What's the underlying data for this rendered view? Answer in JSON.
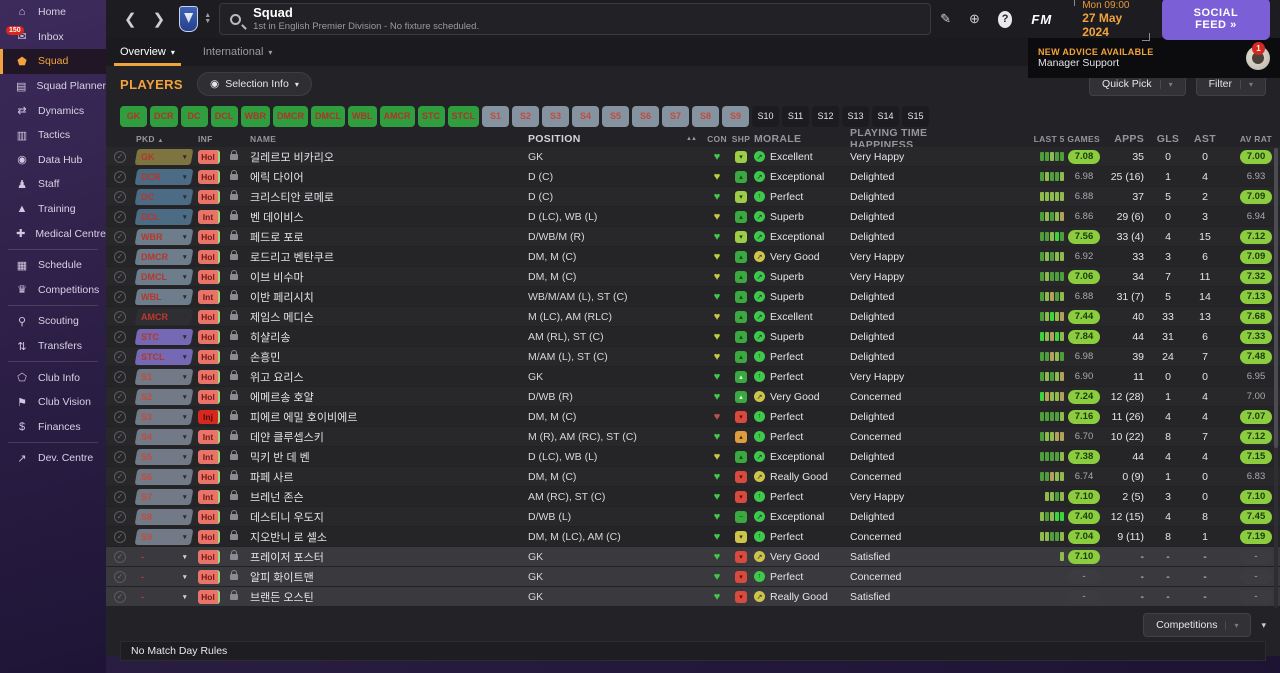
{
  "sidebar": {
    "items": [
      {
        "label": "Home",
        "icon": "home-icon",
        "glyph": "⌂"
      },
      {
        "label": "Inbox",
        "icon": "inbox-icon",
        "glyph": "✉",
        "badge": "150"
      },
      {
        "label": "Squad",
        "icon": "shirt-icon",
        "glyph": "⬟",
        "active": true
      },
      {
        "label": "Squad Planner",
        "icon": "clipboard-icon",
        "glyph": "▤"
      },
      {
        "label": "Dynamics",
        "icon": "dynamics-icon",
        "glyph": "⇄"
      },
      {
        "label": "Tactics",
        "icon": "tactics-board-icon",
        "glyph": "▥"
      },
      {
        "label": "Data Hub",
        "icon": "data-hub-icon",
        "glyph": "◉"
      },
      {
        "label": "Staff",
        "icon": "staff-icon",
        "glyph": "♟"
      },
      {
        "label": "Training",
        "icon": "training-icon",
        "glyph": "▲"
      },
      {
        "label": "Medical Centre",
        "icon": "medical-cross-icon",
        "glyph": "✚",
        "sep_after": true
      },
      {
        "label": "Schedule",
        "icon": "calendar-icon",
        "glyph": "▦"
      },
      {
        "label": "Competitions",
        "icon": "trophy-icon",
        "glyph": "♛",
        "sep_after": true
      },
      {
        "label": "Scouting",
        "icon": "magnifier-icon",
        "glyph": "⚲"
      },
      {
        "label": "Transfers",
        "icon": "transfers-icon",
        "glyph": "⇅",
        "sep_after": true
      },
      {
        "label": "Club Info",
        "icon": "shield-icon",
        "glyph": "⬠"
      },
      {
        "label": "Club Vision",
        "icon": "briefcase-icon",
        "glyph": "⚑"
      },
      {
        "label": "Finances",
        "icon": "finances-icon",
        "glyph": "$",
        "sep_after": true
      },
      {
        "label": "Dev. Centre",
        "icon": "growth-icon",
        "glyph": "↗"
      }
    ]
  },
  "topbar": {
    "title": "Squad",
    "subtitle": "1st in English Premier Division - No fixture scheduled.",
    "date_line1": "Mon 09:00",
    "date_line2": "27 May 2024",
    "social_feed": "SOCIAL FEED",
    "social_feed_arrow": "»",
    "fm_logo": "FM"
  },
  "advice": {
    "line1": "NEW ADVICE AVAILABLE",
    "line2": "Manager Support",
    "badge": "1"
  },
  "tabs": [
    {
      "label": "Overview",
      "active": true
    },
    {
      "label": "International",
      "active": false
    }
  ],
  "players_panel": {
    "title": "PLAYERS",
    "selection_info": "Selection Info",
    "quick_pick": "Quick Pick",
    "filter": "Filter",
    "position_buttons": [
      {
        "label": "GK",
        "style": "green"
      },
      {
        "label": "DCR",
        "style": "green"
      },
      {
        "label": "DC",
        "style": "green"
      },
      {
        "label": "DCL",
        "style": "green"
      },
      {
        "label": "WBR",
        "style": "green"
      },
      {
        "label": "DMCR",
        "style": "green"
      },
      {
        "label": "DMCL",
        "style": "green"
      },
      {
        "label": "WBL",
        "style": "green"
      },
      {
        "label": "AMCR",
        "style": "green"
      },
      {
        "label": "STC",
        "style": "green"
      },
      {
        "label": "STCL",
        "style": "green"
      },
      {
        "label": "S1",
        "style": "gray"
      },
      {
        "label": "S2",
        "style": "gray"
      },
      {
        "label": "S3",
        "style": "gray"
      },
      {
        "label": "S4",
        "style": "gray"
      },
      {
        "label": "S5",
        "style": "gray"
      },
      {
        "label": "S6",
        "style": "gray"
      },
      {
        "label": "S7",
        "style": "gray"
      },
      {
        "label": "S8",
        "style": "gray"
      },
      {
        "label": "S9",
        "style": "gray"
      },
      {
        "label": "S10",
        "style": "dark"
      },
      {
        "label": "S11",
        "style": "dark"
      },
      {
        "label": "S12",
        "style": "dark"
      },
      {
        "label": "S13",
        "style": "dark"
      },
      {
        "label": "S14",
        "style": "dark"
      },
      {
        "label": "S15",
        "style": "dark"
      }
    ]
  },
  "table": {
    "headers": {
      "pkd": "PKD",
      "sort": "▲",
      "inf": "INF",
      "name": "NAME",
      "position": "POSITION",
      "aa": "▲▲",
      "con": "CON",
      "shp": "SHP",
      "morale": "MORALE",
      "happiness": "PLAYING TIME HAPPINESS",
      "last5": "LAST 5 GAMES",
      "apps": "APPS",
      "gls": "GLS",
      "ast": "AST",
      "avrat": "AV RAT"
    },
    "rows": [
      {
        "pkd": "GK",
        "pkd_style": "gk",
        "inf": "Hol",
        "name": "길레르모 비카리오",
        "position": "GK",
        "con": "g",
        "shp": "l",
        "shp_glyph": "▾",
        "morale_color": "g",
        "morale_glyph": "↗",
        "morale": "Excellent",
        "happiness": "Very Happy",
        "blocks": [
          "g",
          "g",
          "l",
          "g",
          "g"
        ],
        "last5": "7.08",
        "last5_style": "green",
        "apps": "35",
        "gls": "0",
        "ast": "0",
        "avrat": "7.00",
        "avrat_style": "green"
      },
      {
        "pkd": "DCR",
        "pkd_style": "d",
        "inf": "Hol",
        "name": "에릭 다이어",
        "position": "D (C)",
        "con": "y",
        "shp": "g",
        "shp_glyph": "▴",
        "morale_color": "g",
        "morale_glyph": "↗",
        "morale": "Exceptional",
        "happiness": "Delighted",
        "blocks": [
          "g",
          "l",
          "g",
          "g",
          "l"
        ],
        "last5": "6.98",
        "last5_style": "plain",
        "apps": "25 (16)",
        "gls": "1",
        "ast": "4",
        "avrat": "6.93",
        "avrat_style": "plain"
      },
      {
        "pkd": "DC",
        "pkd_style": "d",
        "inf": "Hol",
        "name": "크리스티안 로메로",
        "position": "D (C)",
        "con": "g",
        "shp": "l",
        "shp_glyph": "▾",
        "morale_color": "g",
        "morale_glyph": "↑",
        "morale": "Perfect",
        "happiness": "Delighted",
        "blocks": [
          "l",
          "l",
          "l",
          "l",
          "l"
        ],
        "last5": "6.88",
        "last5_style": "plain",
        "apps": "37",
        "gls": "5",
        "ast": "2",
        "avrat": "7.09",
        "avrat_style": "green"
      },
      {
        "pkd": "DCL",
        "pkd_style": "d",
        "inf": "Int",
        "name": "벤 데이비스",
        "position": "D (LC), WB (L)",
        "con": "y",
        "shp": "g",
        "shp_glyph": "▴",
        "morale_color": "g",
        "morale_glyph": "↗",
        "morale": "Superb",
        "happiness": "Delighted",
        "blocks": [
          "g",
          "l",
          "g",
          "l",
          "t"
        ],
        "last5": "6.86",
        "last5_style": "plain",
        "apps": "29 (6)",
        "gls": "0",
        "ast": "3",
        "avrat": "6.94",
        "avrat_style": "plain"
      },
      {
        "pkd": "WBR",
        "pkd_style": "wb",
        "inf": "Hol",
        "name": "페드로 포로",
        "position": "D/WB/M (R)",
        "con": "g",
        "shp": "l",
        "shp_glyph": "▾",
        "morale_color": "g",
        "morale_glyph": "↗",
        "morale": "Exceptional",
        "happiness": "Delighted",
        "blocks": [
          "g",
          "g",
          "l",
          "G",
          "g"
        ],
        "last5": "7.56",
        "last5_style": "green",
        "apps": "33 (4)",
        "gls": "4",
        "ast": "15",
        "avrat": "7.12",
        "avrat_style": "green"
      },
      {
        "pkd": "DMCR",
        "pkd_style": "wb",
        "inf": "Hol",
        "name": "로드리고 벤탄쿠르",
        "position": "DM, M (C)",
        "con": "y",
        "shp": "g",
        "shp_glyph": "▴",
        "morale_color": "y",
        "morale_glyph": "↗",
        "morale": "Very Good",
        "happiness": "Very Happy",
        "blocks": [
          "g",
          "l",
          "g",
          "l",
          "l"
        ],
        "last5": "6.92",
        "last5_style": "plain",
        "apps": "33",
        "gls": "3",
        "ast": "6",
        "avrat": "7.09",
        "avrat_style": "green"
      },
      {
        "pkd": "DMCL",
        "pkd_style": "wb",
        "inf": "Hol",
        "name": "이브 비수마",
        "position": "DM, M (C)",
        "con": "y",
        "shp": "g",
        "shp_glyph": "▴",
        "morale_color": "g",
        "morale_glyph": "↗",
        "morale": "Superb",
        "happiness": "Very Happy",
        "blocks": [
          "g",
          "l",
          "g",
          "g",
          "g"
        ],
        "last5": "7.06",
        "last5_style": "green",
        "apps": "34",
        "gls": "7",
        "ast": "11",
        "avrat": "7.32",
        "avrat_style": "green"
      },
      {
        "pkd": "WBL",
        "pkd_style": "wb",
        "inf": "Int",
        "name": "이반 페리시치",
        "position": "WB/M/AM (L), ST (C)",
        "con": "g",
        "shp": "g",
        "shp_glyph": "▴",
        "morale_color": "g",
        "morale_glyph": "↗",
        "morale": "Superb",
        "happiness": "Delighted",
        "blocks": [
          "g",
          "l",
          "t",
          "g",
          "l"
        ],
        "last5": "6.88",
        "last5_style": "plain",
        "apps": "31 (7)",
        "gls": "5",
        "ast": "14",
        "avrat": "7.13",
        "avrat_style": "green"
      },
      {
        "pkd": "AMCR",
        "pkd_style": "am",
        "inf": "Hol",
        "name": "제임스 메디슨",
        "position": "M (LC), AM (RLC)",
        "con": "y",
        "shp": "g",
        "shp_glyph": "▴",
        "morale_color": "g",
        "morale_glyph": "↗",
        "morale": "Excellent",
        "happiness": "Delighted",
        "blocks": [
          "g",
          "l",
          "G",
          "l",
          "t"
        ],
        "last5": "7.44",
        "last5_style": "green",
        "apps": "40",
        "gls": "33",
        "ast": "13",
        "avrat": "7.68",
        "avrat_style": "green"
      },
      {
        "pkd": "STC",
        "pkd_style": "st",
        "inf": "Hol",
        "name": "히샬리송",
        "position": "AM (RL), ST (C)",
        "con": "y",
        "shp": "g",
        "shp_glyph": "▴",
        "morale_color": "g",
        "morale_glyph": "↗",
        "morale": "Superb",
        "happiness": "Delighted",
        "blocks": [
          "G",
          "l",
          "t",
          "G",
          "l"
        ],
        "last5": "7.84",
        "last5_style": "green",
        "apps": "44",
        "gls": "31",
        "ast": "6",
        "avrat": "7.33",
        "avrat_style": "green"
      },
      {
        "pkd": "STCL",
        "pkd_style": "st",
        "inf": "Hol",
        "name": "손흥민",
        "position": "M/AM (L), ST (C)",
        "con": "y",
        "shp": "g",
        "shp_glyph": "▴",
        "morale_color": "g",
        "morale_glyph": "↑",
        "morale": "Perfect",
        "happiness": "Delighted",
        "blocks": [
          "g",
          "g",
          "t",
          "l",
          "g"
        ],
        "last5": "6.98",
        "last5_style": "plain",
        "apps": "39",
        "gls": "24",
        "ast": "7",
        "avrat": "7.48",
        "avrat_style": "green"
      },
      {
        "pkd": "S1",
        "pkd_style": "s",
        "inf": "Hol",
        "name": "위고 요리스",
        "position": "GK",
        "con": "g",
        "shp": "gw",
        "shp_glyph": "▴",
        "morale_color": "g",
        "morale_glyph": "↑",
        "morale": "Perfect",
        "happiness": "Very Happy",
        "blocks": [
          "g",
          "l",
          "g",
          "l",
          "t"
        ],
        "last5": "6.90",
        "last5_style": "plain",
        "apps": "11",
        "gls": "0",
        "ast": "0",
        "avrat": "6.95",
        "avrat_style": "plain"
      },
      {
        "pkd": "S2",
        "pkd_style": "s",
        "inf": "Hol",
        "name": "에메르송 호얄",
        "position": "D/WB (R)",
        "con": "g",
        "shp": "gw",
        "shp_glyph": "▴",
        "morale_color": "y",
        "morale_glyph": "↗",
        "morale": "Very Good",
        "happiness": "Concerned",
        "blocks": [
          "G",
          "t",
          "l",
          "l",
          "t"
        ],
        "last5": "7.24",
        "last5_style": "green",
        "apps": "12 (28)",
        "gls": "1",
        "ast": "4",
        "avrat": "7.00",
        "avrat_style": "plain"
      },
      {
        "pkd": "S3",
        "pkd_style": "s",
        "inf": "Inj",
        "name": "피에르 에밀 호이비에르",
        "position": "DM, M (C)",
        "con": "r",
        "shp": "r",
        "shp_glyph": "▾",
        "morale_color": "g",
        "morale_glyph": "↑",
        "morale": "Perfect",
        "happiness": "Delighted",
        "blocks": [
          "g",
          "g",
          "g",
          "g",
          "l"
        ],
        "last5": "7.16",
        "last5_style": "green",
        "apps": "11 (26)",
        "gls": "4",
        "ast": "4",
        "avrat": "7.07",
        "avrat_style": "green"
      },
      {
        "pkd": "S4",
        "pkd_style": "s",
        "inf": "Int",
        "name": "데얀 클루셉스키",
        "position": "M (R), AM (RC), ST (C)",
        "con": "g",
        "shp": "o",
        "shp_glyph": "▴",
        "morale_color": "g",
        "morale_glyph": "↑",
        "morale": "Perfect",
        "happiness": "Concerned",
        "blocks": [
          "g",
          "l",
          "l",
          "t",
          "t"
        ],
        "last5": "6.70",
        "last5_style": "plain",
        "apps": "10 (22)",
        "gls": "8",
        "ast": "7",
        "avrat": "7.12",
        "avrat_style": "green"
      },
      {
        "pkd": "S5",
        "pkd_style": "s",
        "inf": "Int",
        "name": "믹키 반 데 벤",
        "position": "D (LC), WB (L)",
        "con": "y",
        "shp": "g",
        "shp_glyph": "▴",
        "morale_color": "g",
        "morale_glyph": "↗",
        "morale": "Exceptional",
        "happiness": "Delighted",
        "blocks": [
          "g",
          "g",
          "g",
          "g",
          "l"
        ],
        "last5": "7.38",
        "last5_style": "green",
        "apps": "44",
        "gls": "4",
        "ast": "4",
        "avrat": "7.15",
        "avrat_style": "green"
      },
      {
        "pkd": "S6",
        "pkd_style": "s",
        "inf": "Hol",
        "name": "파페 사르",
        "position": "DM, M (C)",
        "con": "g",
        "shp": "r",
        "shp_glyph": "▾",
        "morale_color": "y",
        "morale_glyph": "↗",
        "morale": "Really Good",
        "happiness": "Concerned",
        "blocks": [
          "g",
          "g",
          "t",
          "l",
          "l"
        ],
        "last5": "6.74",
        "last5_style": "plain",
        "apps": "0 (9)",
        "gls": "1",
        "ast": "0",
        "avrat": "6.83",
        "avrat_style": "plain"
      },
      {
        "pkd": "S7",
        "pkd_style": "s",
        "inf": "Int",
        "name": "브레넌 존슨",
        "position": "AM (RC), ST (C)",
        "con": "g",
        "shp": "r",
        "shp_glyph": "▾",
        "morale_color": "g",
        "morale_glyph": "↑",
        "morale": "Perfect",
        "happiness": "Very Happy",
        "blocks": [
          "l",
          "l",
          "g",
          "l"
        ],
        "last5": "7.10",
        "last5_style": "green",
        "apps": "2 (5)",
        "gls": "3",
        "ast": "0",
        "avrat": "7.10",
        "avrat_style": "green"
      },
      {
        "pkd": "S8",
        "pkd_style": "s",
        "inf": "Hol",
        "name": "데스티니 우도지",
        "position": "D/WB (L)",
        "con": "g",
        "shp": "g",
        "shp_glyph": "−",
        "morale_color": "g",
        "morale_glyph": "↗",
        "morale": "Exceptional",
        "happiness": "Delighted",
        "blocks": [
          "l",
          "g",
          "l",
          "G",
          "G"
        ],
        "last5": "7.40",
        "last5_style": "green",
        "apps": "12 (15)",
        "gls": "4",
        "ast": "8",
        "avrat": "7.45",
        "avrat_style": "green"
      },
      {
        "pkd": "S9",
        "pkd_style": "s",
        "inf": "Hol",
        "name": "지오반니 로 셀소",
        "position": "DM, M (LC), AM (C)",
        "con": "g",
        "shp": "y",
        "shp_glyph": "▾",
        "morale_color": "g",
        "morale_glyph": "↑",
        "morale": "Perfect",
        "happiness": "Concerned",
        "blocks": [
          "l",
          "l",
          "g",
          "g",
          "l"
        ],
        "last5": "7.04",
        "last5_style": "green",
        "apps": "9 (11)",
        "gls": "8",
        "ast": "1",
        "avrat": "7.19",
        "avrat_style": "green"
      },
      {
        "pkd": "-",
        "pkd_style": "none",
        "inf": "Hol",
        "name": "프레이저 포스터",
        "position": "GK",
        "con": "g",
        "shp": "r",
        "shp_glyph": "▾",
        "morale_color": "y",
        "morale_glyph": "↗",
        "morale": "Very Good",
        "happiness": "Satisfied",
        "blocks": [
          "l"
        ],
        "last5": "7.10",
        "last5_style": "green",
        "apps": "-",
        "gls": "-",
        "ast": "-",
        "avrat": "-",
        "avrat_style": "gray",
        "selected": true
      },
      {
        "pkd": "-",
        "pkd_style": "none",
        "inf": "Hol",
        "name": "알피 화이트맨",
        "position": "GK",
        "con": "g",
        "shp": "r",
        "shp_glyph": "▾",
        "morale_color": "g",
        "morale_glyph": "↑",
        "morale": "Perfect",
        "happiness": "Concerned",
        "blocks": [],
        "last5": "-",
        "last5_style": "gray",
        "apps": "-",
        "gls": "-",
        "ast": "-",
        "avrat": "-",
        "avrat_style": "gray",
        "selected": true
      },
      {
        "pkd": "-",
        "pkd_style": "none",
        "inf": "Hol",
        "name": "브랜든 오스틴",
        "position": "GK",
        "con": "g",
        "shp": "r",
        "shp_glyph": "▾",
        "morale_color": "y",
        "morale_glyph": "↗",
        "morale": "Really Good",
        "happiness": "Satisfied",
        "blocks": [],
        "last5": "-",
        "last5_style": "gray",
        "apps": "-",
        "gls": "-",
        "ast": "-",
        "avrat": "-",
        "avrat_style": "gray",
        "selected": true
      }
    ]
  },
  "footer": {
    "competitions": "Competitions",
    "no_match_day_rules": "No Match Day Rules"
  }
}
